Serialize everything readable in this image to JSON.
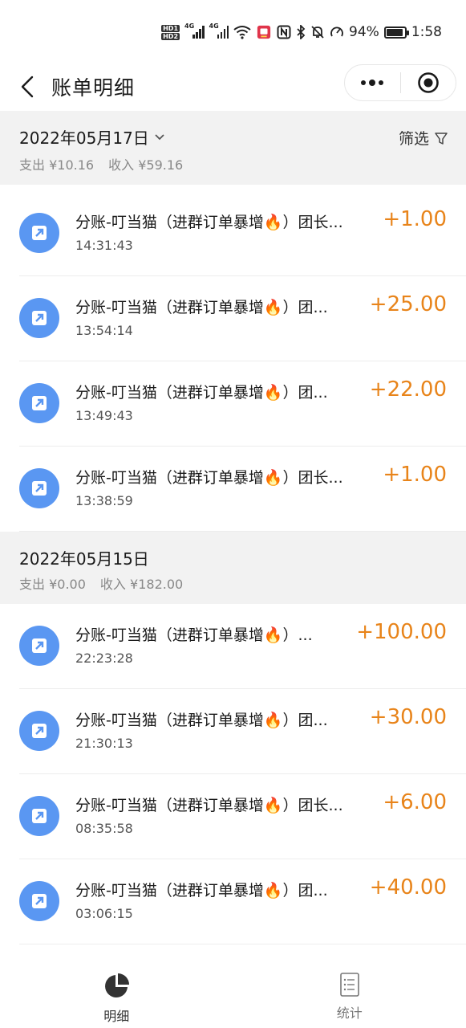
{
  "status_bar": {
    "hd1": "HD1",
    "hd2": "HD2",
    "signal1_tag": "4G",
    "signal2_tag": "4G",
    "battery_percent": "94%",
    "battery_level": 0.94,
    "time": "1:58",
    "icons": [
      "wifi-icon",
      "app-notification-icon",
      "nfc-icon",
      "bluetooth-icon",
      "mute-icon",
      "speed-icon",
      "battery-icon"
    ]
  },
  "nav": {
    "title": "账单明细",
    "back_icon": "chevron-left-icon",
    "more_icon": "more-dots-icon",
    "close_icon": "target-circle-icon"
  },
  "sections": [
    {
      "date": "2022年05月17日",
      "has_dropdown": true,
      "expense_label": "支出",
      "expense_value": "¥10.16",
      "income_label": "收入",
      "income_value": "¥59.16",
      "filter_label": "筛选",
      "items": [
        {
          "title": "分账-叮当猫（进群订单暴增🔥）团长...",
          "time": "14:31:43",
          "amount": "+1.00"
        },
        {
          "title": "分账-叮当猫（进群订单暴增🔥）团...",
          "time": "13:54:14",
          "amount": "+25.00"
        },
        {
          "title": "分账-叮当猫（进群订单暴增🔥）团...",
          "time": "13:49:43",
          "amount": "+22.00"
        },
        {
          "title": "分账-叮当猫（进群订单暴增🔥）团长...",
          "time": "13:38:59",
          "amount": "+1.00"
        }
      ]
    },
    {
      "date": "2022年05月15日",
      "expense_label": "支出",
      "expense_value": "¥0.00",
      "income_label": "收入",
      "income_value": "¥182.00",
      "items": [
        {
          "title": "分账-叮当猫（进群订单暴增🔥）...",
          "time": "22:23:28",
          "amount": "+100.00"
        },
        {
          "title": "分账-叮当猫（进群订单暴增🔥）团...",
          "time": "21:30:13",
          "amount": "+30.00"
        },
        {
          "title": "分账-叮当猫（进群订单暴增🔥）团长...",
          "time": "08:35:58",
          "amount": "+6.00"
        },
        {
          "title": "分账-叮当猫（进群订单暴增🔥）团...",
          "time": "03:06:15",
          "amount": "+40.00"
        }
      ]
    }
  ],
  "tabs": [
    {
      "label": "明细",
      "icon": "pie-chart-icon",
      "active": true
    },
    {
      "label": "统计",
      "icon": "list-document-icon",
      "active": false
    }
  ],
  "colors": {
    "accent_amount": "#e8841a",
    "icon_blue": "#5a97f2",
    "header_bg": "#f2f2f2"
  }
}
